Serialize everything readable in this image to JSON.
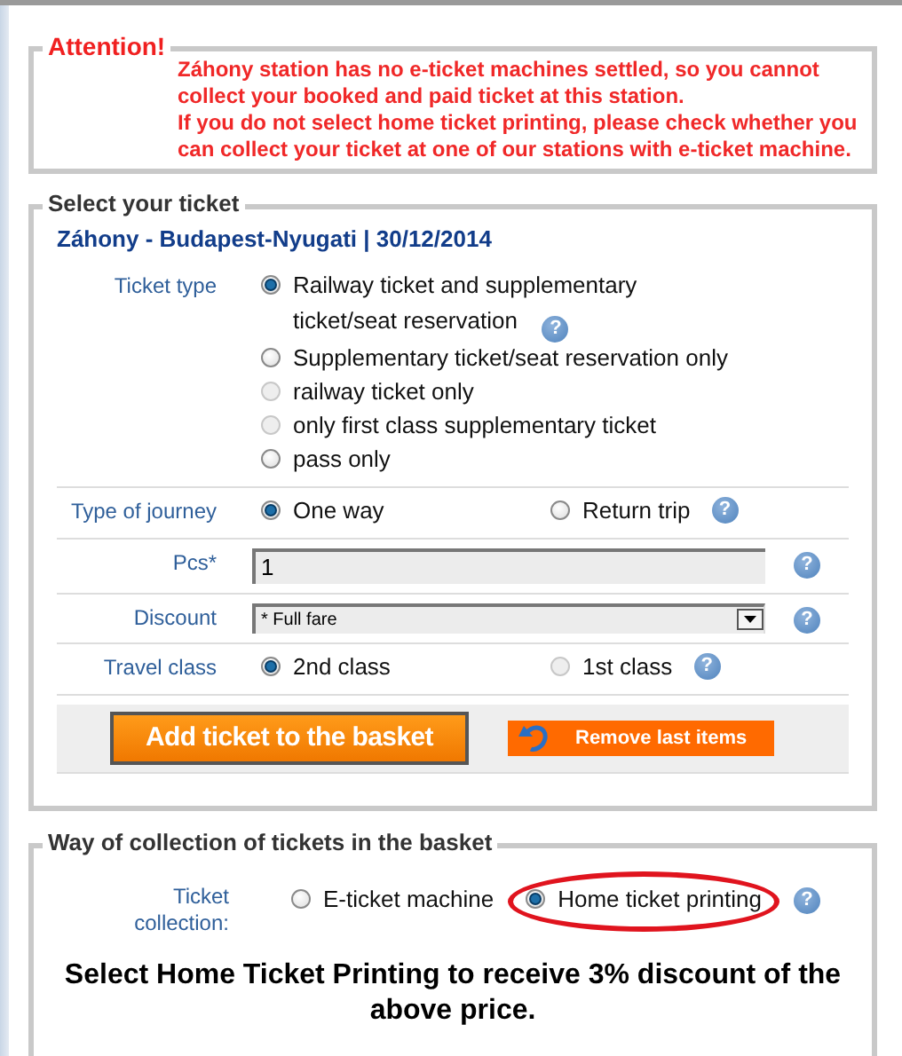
{
  "attention": {
    "title": "Attention!",
    "paragraphs": [
      "Záhony station has no e-ticket machines settled, so you cannot collect your booked and paid ticket at this station.",
      "If you do not select home ticket printing, please check whether you can collect your ticket at one of our stations with e-ticket machine."
    ]
  },
  "ticket_section": {
    "legend": "Select your ticket",
    "route": "Záhony - Budapest-Nyugati | 30/12/2014",
    "rows": [
      {
        "kind": "radiolist",
        "label": "Ticket type",
        "options": [
          {
            "label": "Railway ticket and supplementary ticket/seat reservation",
            "selected": true,
            "disabled": false,
            "help": "?"
          },
          {
            "label": "Supplementary ticket/seat reservation only",
            "selected": false,
            "disabled": false
          },
          {
            "label": "railway ticket only",
            "selected": false,
            "disabled": true
          },
          {
            "label": "only first class supplementary ticket",
            "selected": false,
            "disabled": true
          },
          {
            "label": "pass only",
            "selected": false,
            "disabled": false
          }
        ]
      },
      {
        "kind": "radios",
        "label": "Type of journey",
        "help": "?",
        "options": [
          {
            "label": "One way",
            "selected": true,
            "disabled": false
          },
          {
            "label": "Return trip",
            "selected": false,
            "disabled": false
          }
        ]
      },
      {
        "kind": "text",
        "label": "Pcs*",
        "value": "1",
        "help": "?"
      },
      {
        "kind": "select",
        "label": "Discount",
        "value": "* Full fare",
        "help": "?"
      },
      {
        "kind": "radios",
        "label": "Travel class",
        "help": "?",
        "options": [
          {
            "label": "2nd class",
            "selected": true,
            "disabled": false
          },
          {
            "label": "1st class",
            "selected": false,
            "disabled": true
          }
        ]
      }
    ],
    "buttons": [
      {
        "kind": "primary",
        "label": "Add ticket to the basket"
      },
      {
        "kind": "undo",
        "label": "Remove last items"
      }
    ]
  },
  "collection_section": {
    "legend": "Way of collection of tickets in the basket",
    "label": "Ticket collection:",
    "help": "?",
    "options": [
      {
        "label": "E-ticket machine",
        "selected": false,
        "disabled": false,
        "highlighted": false
      },
      {
        "label": "Home ticket printing",
        "selected": true,
        "disabled": false,
        "highlighted": true
      }
    ],
    "note": "Select Home Ticket Printing to receive 3% discount of the above price."
  }
}
